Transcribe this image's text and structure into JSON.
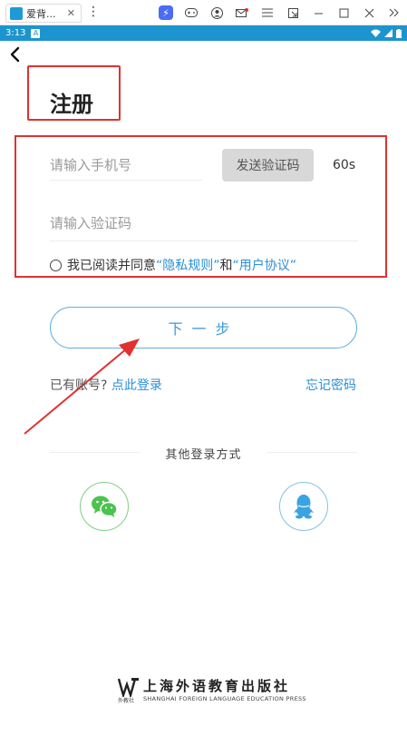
{
  "emulator": {
    "tab_title": "爱背...",
    "tab_close": "✕",
    "menu_dots": "⋮",
    "icons": [
      "bolt-icon",
      "gamepad-icon",
      "account-icon",
      "mail-icon",
      "menu-icon",
      "popout-icon",
      "minimize-icon",
      "maximize-icon",
      "close-icon",
      "expand-icon"
    ]
  },
  "status_bar": {
    "time": "3:13",
    "sim_label": "A"
  },
  "page": {
    "title": "注册"
  },
  "form": {
    "phone_placeholder": "请输入手机号",
    "send_code_label": "发送验证码",
    "countdown": "60s",
    "code_placeholder": "请输入验证码",
    "agree_prefix": "我已阅读并同意",
    "privacy_link": "“隐私规则”",
    "agree_and": "和",
    "terms_link": "“用户协议”"
  },
  "actions": {
    "next_label": "下一步",
    "have_account": "已有账号?",
    "login_link": "点此登录",
    "forgot_password": "忘记密码"
  },
  "other_login": {
    "label": "其他登录方式"
  },
  "publisher": {
    "name_cn": "上海外语教育出版社",
    "name_en": "SHANGHAI FOREIGN LANGUAGE EDUCATION PRESS",
    "short": "外教社"
  },
  "colors": {
    "status_bar": "#1b94cf",
    "accent_blue": "#2b8fd6",
    "annotation_red": "#e0322f",
    "wechat_green": "#4cc24f",
    "qq_blue": "#3aa3e3"
  }
}
